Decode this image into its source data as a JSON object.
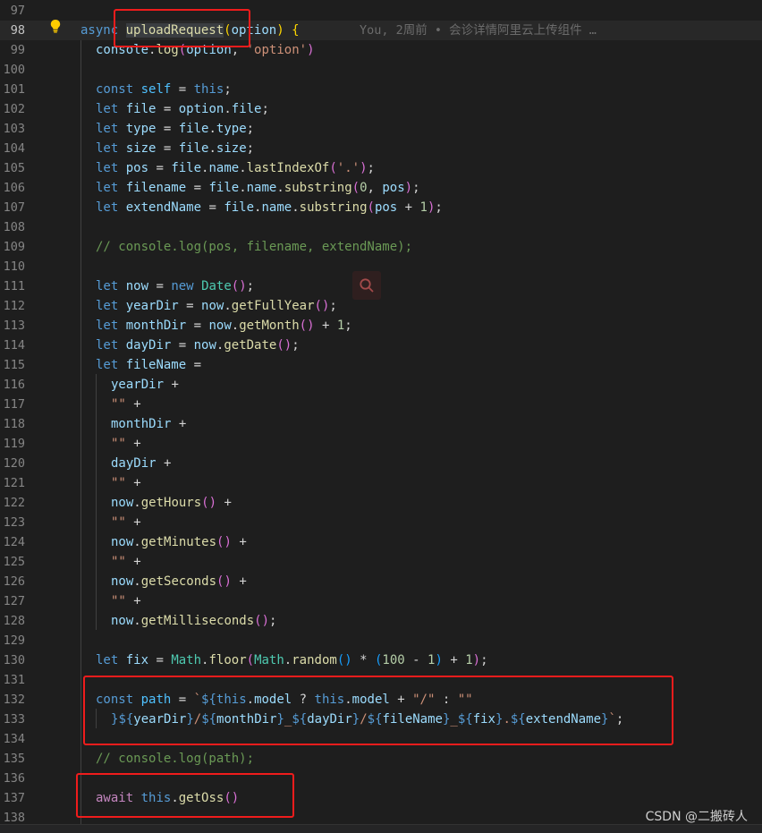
{
  "editor": {
    "current_line": 98,
    "blame": "You, 2周前 • 会诊详情阿里云上传组件 …",
    "lines": [
      {
        "n": 97,
        "indent": 0,
        "tokens": []
      },
      {
        "n": 98,
        "indent": 0,
        "tokens": [
          [
            "k",
            "async"
          ],
          [
            "p",
            " "
          ],
          [
            "f",
            "uploadRequest",
            "hl"
          ],
          [
            "b1",
            "("
          ],
          [
            "v",
            "option"
          ],
          [
            "b1",
            ")"
          ],
          [
            "p",
            " "
          ],
          [
            "b1",
            "{"
          ]
        ]
      },
      {
        "n": 99,
        "indent": 1,
        "tokens": [
          [
            "v",
            "console"
          ],
          [
            "p",
            "."
          ],
          [
            "f",
            "log"
          ],
          [
            "b2",
            "("
          ],
          [
            "v",
            "option"
          ],
          [
            "p",
            ", "
          ],
          [
            "s",
            "'option'"
          ],
          [
            "b2",
            ")"
          ]
        ]
      },
      {
        "n": 100,
        "indent": 0,
        "tokens": []
      },
      {
        "n": 101,
        "indent": 1,
        "tokens": [
          [
            "k",
            "const"
          ],
          [
            "p",
            " "
          ],
          [
            "c",
            "self"
          ],
          [
            "p",
            " = "
          ],
          [
            "k",
            "this"
          ],
          [
            "p",
            ";"
          ]
        ]
      },
      {
        "n": 102,
        "indent": 1,
        "tokens": [
          [
            "k",
            "let"
          ],
          [
            "p",
            " "
          ],
          [
            "v",
            "file"
          ],
          [
            "p",
            " = "
          ],
          [
            "v",
            "option"
          ],
          [
            "p",
            "."
          ],
          [
            "v",
            "file"
          ],
          [
            "p",
            ";"
          ]
        ]
      },
      {
        "n": 103,
        "indent": 1,
        "tokens": [
          [
            "k",
            "let"
          ],
          [
            "p",
            " "
          ],
          [
            "v",
            "type"
          ],
          [
            "p",
            " = "
          ],
          [
            "v",
            "file"
          ],
          [
            "p",
            "."
          ],
          [
            "v",
            "type"
          ],
          [
            "p",
            ";"
          ]
        ]
      },
      {
        "n": 104,
        "indent": 1,
        "tokens": [
          [
            "k",
            "let"
          ],
          [
            "p",
            " "
          ],
          [
            "v",
            "size"
          ],
          [
            "p",
            " = "
          ],
          [
            "v",
            "file"
          ],
          [
            "p",
            "."
          ],
          [
            "v",
            "size"
          ],
          [
            "p",
            ";"
          ]
        ]
      },
      {
        "n": 105,
        "indent": 1,
        "tokens": [
          [
            "k",
            "let"
          ],
          [
            "p",
            " "
          ],
          [
            "v",
            "pos"
          ],
          [
            "p",
            " = "
          ],
          [
            "v",
            "file"
          ],
          [
            "p",
            "."
          ],
          [
            "v",
            "name"
          ],
          [
            "p",
            "."
          ],
          [
            "f",
            "lastIndexOf"
          ],
          [
            "b2",
            "("
          ],
          [
            "s",
            "'.'"
          ],
          [
            "b2",
            ")"
          ],
          [
            "p",
            ";"
          ]
        ]
      },
      {
        "n": 106,
        "indent": 1,
        "tokens": [
          [
            "k",
            "let"
          ],
          [
            "p",
            " "
          ],
          [
            "v",
            "filename"
          ],
          [
            "p",
            " = "
          ],
          [
            "v",
            "file"
          ],
          [
            "p",
            "."
          ],
          [
            "v",
            "name"
          ],
          [
            "p",
            "."
          ],
          [
            "f",
            "substring"
          ],
          [
            "b2",
            "("
          ],
          [
            "n",
            "0"
          ],
          [
            "p",
            ", "
          ],
          [
            "v",
            "pos"
          ],
          [
            "b2",
            ")"
          ],
          [
            "p",
            ";"
          ]
        ]
      },
      {
        "n": 107,
        "indent": 1,
        "tokens": [
          [
            "k",
            "let"
          ],
          [
            "p",
            " "
          ],
          [
            "v",
            "extendName"
          ],
          [
            "p",
            " = "
          ],
          [
            "v",
            "file"
          ],
          [
            "p",
            "."
          ],
          [
            "v",
            "name"
          ],
          [
            "p",
            "."
          ],
          [
            "f",
            "substring"
          ],
          [
            "b2",
            "("
          ],
          [
            "v",
            "pos"
          ],
          [
            "p",
            " + "
          ],
          [
            "n",
            "1"
          ],
          [
            "b2",
            ")"
          ],
          [
            "p",
            ";"
          ]
        ]
      },
      {
        "n": 108,
        "indent": 0,
        "tokens": []
      },
      {
        "n": 109,
        "indent": 1,
        "tokens": [
          [
            "cm",
            "// console.log(pos, filename, extendName);"
          ]
        ]
      },
      {
        "n": 110,
        "indent": 0,
        "tokens": []
      },
      {
        "n": 111,
        "indent": 1,
        "tokens": [
          [
            "k",
            "let"
          ],
          [
            "p",
            " "
          ],
          [
            "v",
            "now"
          ],
          [
            "p",
            " = "
          ],
          [
            "k",
            "new"
          ],
          [
            "p",
            " "
          ],
          [
            "t",
            "Date"
          ],
          [
            "b2",
            "("
          ],
          [
            "b2",
            ")"
          ],
          [
            "p",
            ";"
          ]
        ]
      },
      {
        "n": 112,
        "indent": 1,
        "tokens": [
          [
            "k",
            "let"
          ],
          [
            "p",
            " "
          ],
          [
            "v",
            "yearDir"
          ],
          [
            "p",
            " = "
          ],
          [
            "v",
            "now"
          ],
          [
            "p",
            "."
          ],
          [
            "f",
            "getFullYear"
          ],
          [
            "b2",
            "("
          ],
          [
            "b2",
            ")"
          ],
          [
            "p",
            ";"
          ]
        ]
      },
      {
        "n": 113,
        "indent": 1,
        "tokens": [
          [
            "k",
            "let"
          ],
          [
            "p",
            " "
          ],
          [
            "v",
            "monthDir"
          ],
          [
            "p",
            " = "
          ],
          [
            "v",
            "now"
          ],
          [
            "p",
            "."
          ],
          [
            "f",
            "getMonth"
          ],
          [
            "b2",
            "("
          ],
          [
            "b2",
            ")"
          ],
          [
            "p",
            " + "
          ],
          [
            "n",
            "1"
          ],
          [
            "p",
            ";"
          ]
        ]
      },
      {
        "n": 114,
        "indent": 1,
        "tokens": [
          [
            "k",
            "let"
          ],
          [
            "p",
            " "
          ],
          [
            "v",
            "dayDir"
          ],
          [
            "p",
            " = "
          ],
          [
            "v",
            "now"
          ],
          [
            "p",
            "."
          ],
          [
            "f",
            "getDate"
          ],
          [
            "b2",
            "("
          ],
          [
            "b2",
            ")"
          ],
          [
            "p",
            ";"
          ]
        ]
      },
      {
        "n": 115,
        "indent": 1,
        "tokens": [
          [
            "k",
            "let"
          ],
          [
            "p",
            " "
          ],
          [
            "v",
            "fileName"
          ],
          [
            "p",
            " ="
          ]
        ]
      },
      {
        "n": 116,
        "indent": 2,
        "tokens": [
          [
            "v",
            "yearDir"
          ],
          [
            "p",
            " +"
          ]
        ]
      },
      {
        "n": 117,
        "indent": 2,
        "tokens": [
          [
            "s",
            "\"\""
          ],
          [
            "p",
            " +"
          ]
        ]
      },
      {
        "n": 118,
        "indent": 2,
        "tokens": [
          [
            "v",
            "monthDir"
          ],
          [
            "p",
            " +"
          ]
        ]
      },
      {
        "n": 119,
        "indent": 2,
        "tokens": [
          [
            "s",
            "\"\""
          ],
          [
            "p",
            " +"
          ]
        ]
      },
      {
        "n": 120,
        "indent": 2,
        "tokens": [
          [
            "v",
            "dayDir"
          ],
          [
            "p",
            " +"
          ]
        ]
      },
      {
        "n": 121,
        "indent": 2,
        "tokens": [
          [
            "s",
            "\"\""
          ],
          [
            "p",
            " +"
          ]
        ]
      },
      {
        "n": 122,
        "indent": 2,
        "tokens": [
          [
            "v",
            "now"
          ],
          [
            "p",
            "."
          ],
          [
            "f",
            "getHours"
          ],
          [
            "b2",
            "("
          ],
          [
            "b2",
            ")"
          ],
          [
            "p",
            " +"
          ]
        ]
      },
      {
        "n": 123,
        "indent": 2,
        "tokens": [
          [
            "s",
            "\"\""
          ],
          [
            "p",
            " +"
          ]
        ]
      },
      {
        "n": 124,
        "indent": 2,
        "tokens": [
          [
            "v",
            "now"
          ],
          [
            "p",
            "."
          ],
          [
            "f",
            "getMinutes"
          ],
          [
            "b2",
            "("
          ],
          [
            "b2",
            ")"
          ],
          [
            "p",
            " +"
          ]
        ]
      },
      {
        "n": 125,
        "indent": 2,
        "tokens": [
          [
            "s",
            "\"\""
          ],
          [
            "p",
            " +"
          ]
        ]
      },
      {
        "n": 126,
        "indent": 2,
        "tokens": [
          [
            "v",
            "now"
          ],
          [
            "p",
            "."
          ],
          [
            "f",
            "getSeconds"
          ],
          [
            "b2",
            "("
          ],
          [
            "b2",
            ")"
          ],
          [
            "p",
            " +"
          ]
        ]
      },
      {
        "n": 127,
        "indent": 2,
        "tokens": [
          [
            "s",
            "\"\""
          ],
          [
            "p",
            " +"
          ]
        ]
      },
      {
        "n": 128,
        "indent": 2,
        "tokens": [
          [
            "v",
            "now"
          ],
          [
            "p",
            "."
          ],
          [
            "f",
            "getMilliseconds"
          ],
          [
            "b2",
            "("
          ],
          [
            "b2",
            ")"
          ],
          [
            "p",
            ";"
          ]
        ]
      },
      {
        "n": 129,
        "indent": 0,
        "tokens": []
      },
      {
        "n": 130,
        "indent": 1,
        "tokens": [
          [
            "k",
            "let"
          ],
          [
            "p",
            " "
          ],
          [
            "v",
            "fix"
          ],
          [
            "p",
            " = "
          ],
          [
            "t",
            "Math"
          ],
          [
            "p",
            "."
          ],
          [
            "f",
            "floor"
          ],
          [
            "b2",
            "("
          ],
          [
            "t",
            "Math"
          ],
          [
            "p",
            "."
          ],
          [
            "f",
            "random"
          ],
          [
            "b3",
            "("
          ],
          [
            "b3",
            ")"
          ],
          [
            "p",
            " * "
          ],
          [
            "b3",
            "("
          ],
          [
            "n",
            "100"
          ],
          [
            "p",
            " - "
          ],
          [
            "n",
            "1"
          ],
          [
            "b3",
            ")"
          ],
          [
            "p",
            " + "
          ],
          [
            "n",
            "1"
          ],
          [
            "b2",
            ")"
          ],
          [
            "p",
            ";"
          ]
        ]
      },
      {
        "n": 131,
        "indent": 0,
        "tokens": []
      },
      {
        "n": 132,
        "indent": 1,
        "tokens": [
          [
            "k",
            "const"
          ],
          [
            "p",
            " "
          ],
          [
            "c",
            "path"
          ],
          [
            "p",
            " = "
          ],
          [
            "s",
            "`"
          ],
          [
            "k",
            "${"
          ],
          [
            "k",
            "this"
          ],
          [
            "p",
            "."
          ],
          [
            "v",
            "model"
          ],
          [
            "p",
            " ? "
          ],
          [
            "k",
            "this"
          ],
          [
            "p",
            "."
          ],
          [
            "v",
            "model"
          ],
          [
            "p",
            " + "
          ],
          [
            "s",
            "\"/\""
          ],
          [
            "p",
            " : "
          ],
          [
            "s",
            "\"\""
          ]
        ]
      },
      {
        "n": 133,
        "indent": 2,
        "tokens": [
          [
            "k",
            "}"
          ],
          [
            "k",
            "${"
          ],
          [
            "v",
            "yearDir"
          ],
          [
            "k",
            "}"
          ],
          [
            "s",
            "/"
          ],
          [
            "k",
            "${"
          ],
          [
            "v",
            "monthDir"
          ],
          [
            "k",
            "}"
          ],
          [
            "s",
            "_"
          ],
          [
            "k",
            "${"
          ],
          [
            "v",
            "dayDir"
          ],
          [
            "k",
            "}"
          ],
          [
            "s",
            "/"
          ],
          [
            "k",
            "${"
          ],
          [
            "v",
            "fileName"
          ],
          [
            "k",
            "}"
          ],
          [
            "s",
            "_"
          ],
          [
            "k",
            "${"
          ],
          [
            "v",
            "fix"
          ],
          [
            "k",
            "}"
          ],
          [
            "s",
            "."
          ],
          [
            "k",
            "${"
          ],
          [
            "v",
            "extendName"
          ],
          [
            "k",
            "}"
          ],
          [
            "s",
            "`"
          ],
          [
            "p",
            ";"
          ]
        ]
      },
      {
        "n": 134,
        "indent": 0,
        "tokens": []
      },
      {
        "n": 135,
        "indent": 1,
        "tokens": [
          [
            "cm",
            "// console.log(path);"
          ]
        ]
      },
      {
        "n": 136,
        "indent": 0,
        "tokens": []
      },
      {
        "n": 137,
        "indent": 1,
        "tokens": [
          [
            "ctl",
            "await"
          ],
          [
            "p",
            " "
          ],
          [
            "k",
            "this"
          ],
          [
            "p",
            "."
          ],
          [
            "f",
            "getOss"
          ],
          [
            "b2",
            "("
          ],
          [
            "b2",
            ")"
          ]
        ]
      },
      {
        "n": 138,
        "indent": 0,
        "tokens": []
      }
    ]
  },
  "watermark": "CSDN @二搬砖人",
  "icons": {
    "lightbulb": "lightbulb-icon",
    "search": "search-icon"
  }
}
